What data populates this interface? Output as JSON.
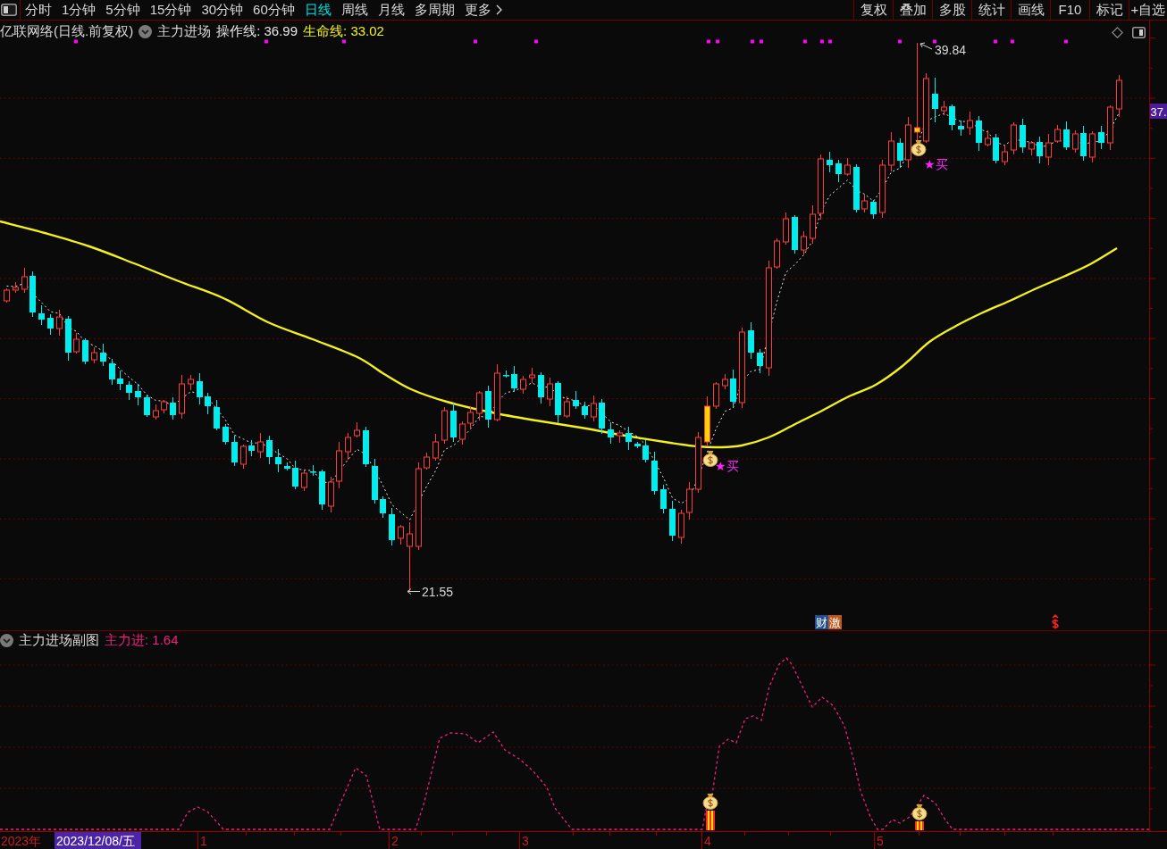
{
  "toolbar": {
    "periods": [
      {
        "label": "分时",
        "selected": false
      },
      {
        "label": "1分钟",
        "selected": false
      },
      {
        "label": "5分钟",
        "selected": false
      },
      {
        "label": "15分钟",
        "selected": false
      },
      {
        "label": "30分钟",
        "selected": false
      },
      {
        "label": "60分钟",
        "selected": false
      },
      {
        "label": "日线",
        "selected": true
      },
      {
        "label": "周线",
        "selected": false
      },
      {
        "label": "月线",
        "selected": false
      },
      {
        "label": "多周期",
        "selected": false
      }
    ],
    "more": {
      "label": "更多"
    },
    "buttons": [
      "复权",
      "叠加",
      "多股",
      "统计",
      "画线",
      "F10",
      "标记",
      "+自选"
    ]
  },
  "main_chart": {
    "title": "亿联网络(日线.前复权)",
    "indicator": "主力进场",
    "legend": [
      {
        "text": "操作线: 36.99",
        "color": "#e6e6e6"
      },
      {
        "text": "生命线: 33.02",
        "color": "#f2f01e"
      }
    ],
    "high_label": "39.84",
    "low_label": "21.55",
    "price_tag": "37.",
    "buy_signals": [
      {
        "label": "★买"
      },
      {
        "label": "★买"
      }
    ],
    "event_badges": [
      {
        "text": "财",
        "color": "#22508e"
      },
      {
        "text": "激",
        "color": "#c0561e"
      }
    ]
  },
  "sub_chart": {
    "title": "主力进场副图",
    "legend": {
      "text": "主力进: 1.64",
      "color": "#f0207f"
    }
  },
  "time_axis": {
    "year": "2023年",
    "cursor_date": "2023/12/08/五",
    "months": [
      "1",
      "2",
      "3",
      "4",
      "5"
    ]
  }
}
